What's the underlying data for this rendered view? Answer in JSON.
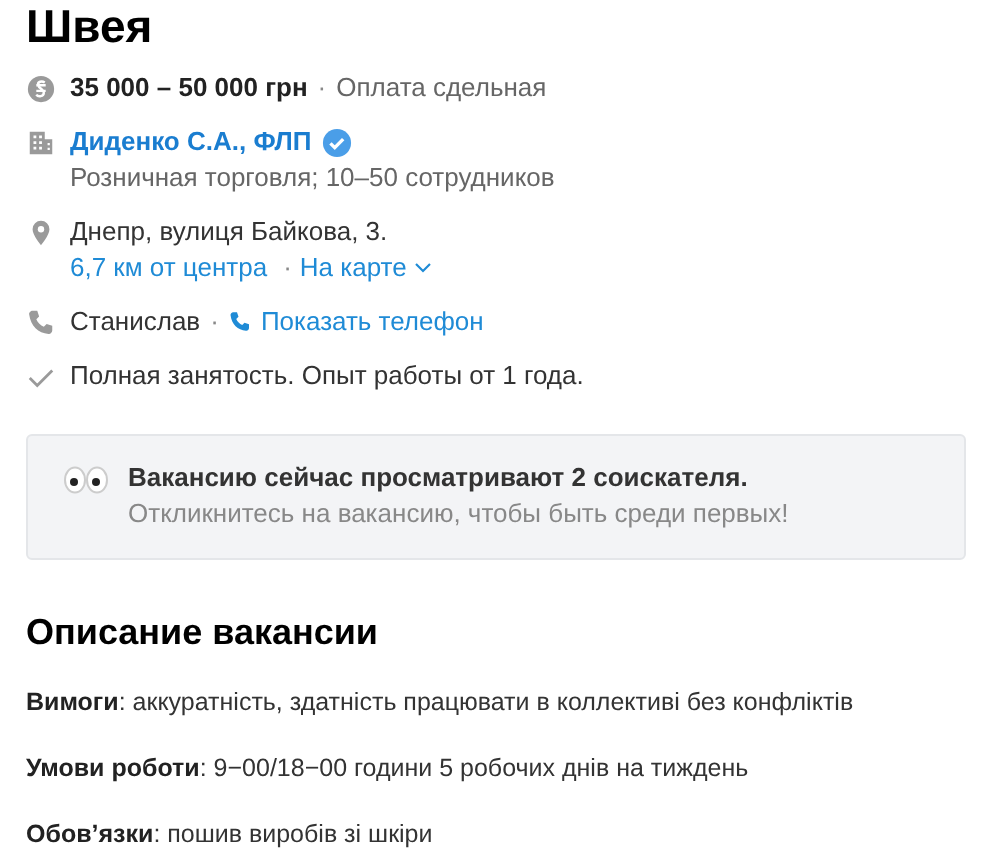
{
  "title": "Швея",
  "salary": {
    "amount": "35 000 – 50 000 грн",
    "separator": "·",
    "note": "Оплата сдельная"
  },
  "company": {
    "name": "Диденко С.А., ФЛП",
    "verified": true,
    "info": "Розничная торговля; 10–50 сотрудников"
  },
  "location": {
    "address": "Днепр, вулиця Байкова, 3.",
    "distance": "6,7 км от центра",
    "separator": "·",
    "map_link": "На карте"
  },
  "contact": {
    "name": "Станислав",
    "separator": "·",
    "phone_link": "Показать телефон"
  },
  "conditions": "Полная занятость. Опыт работы от 1 года.",
  "notice": {
    "title": "Вакансию сейчас просматривают 2 соискателя.",
    "subtitle": "Откликнитесь на вакансию, чтобы быть среди первых!"
  },
  "description": {
    "heading": "Описание вакансии",
    "paragraphs": [
      "**Вимоги**: аккуратність, здатність працювати в коллективі без конфліктів",
      "**Умови роботи**: 9−00/18−00 години 5 робочих днів на тиждень",
      "**Обов’язки**: пошив виробів зі шкіри"
    ]
  }
}
